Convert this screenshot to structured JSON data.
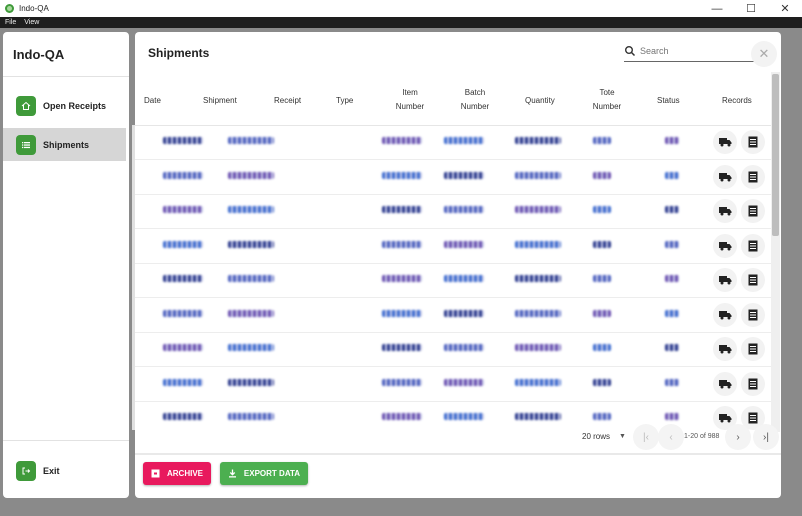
{
  "window": {
    "title": "Indo-QA",
    "controls": [
      "—",
      "☐",
      "✕"
    ]
  },
  "menu": [
    "File",
    "View"
  ],
  "sidebar": {
    "brand": "Indo-QA",
    "items": [
      {
        "label": "Open Receipts",
        "icon": "home-icon",
        "active": false
      },
      {
        "label": "Shipments",
        "icon": "list-icon",
        "active": true
      }
    ],
    "exit_label": "Exit"
  },
  "main": {
    "title": "Shipments",
    "search": {
      "placeholder": "Search"
    },
    "columns": [
      "Date",
      "Shipment",
      "Receipt",
      "Type",
      "Item Number",
      "Batch Number",
      "Quantity",
      "Tote Number",
      "Status",
      "Records"
    ],
    "row_count_visible": 9,
    "pagination": {
      "rows_per_page": "20 rows",
      "range": "1-20 of 988"
    },
    "buttons": {
      "archive": "ARCHIVE",
      "export": "EXPORT DATA"
    }
  },
  "colors": {
    "accent_green": "#3f9a3a",
    "archive_pink": "#e8195d",
    "export_green": "#4caf50"
  }
}
